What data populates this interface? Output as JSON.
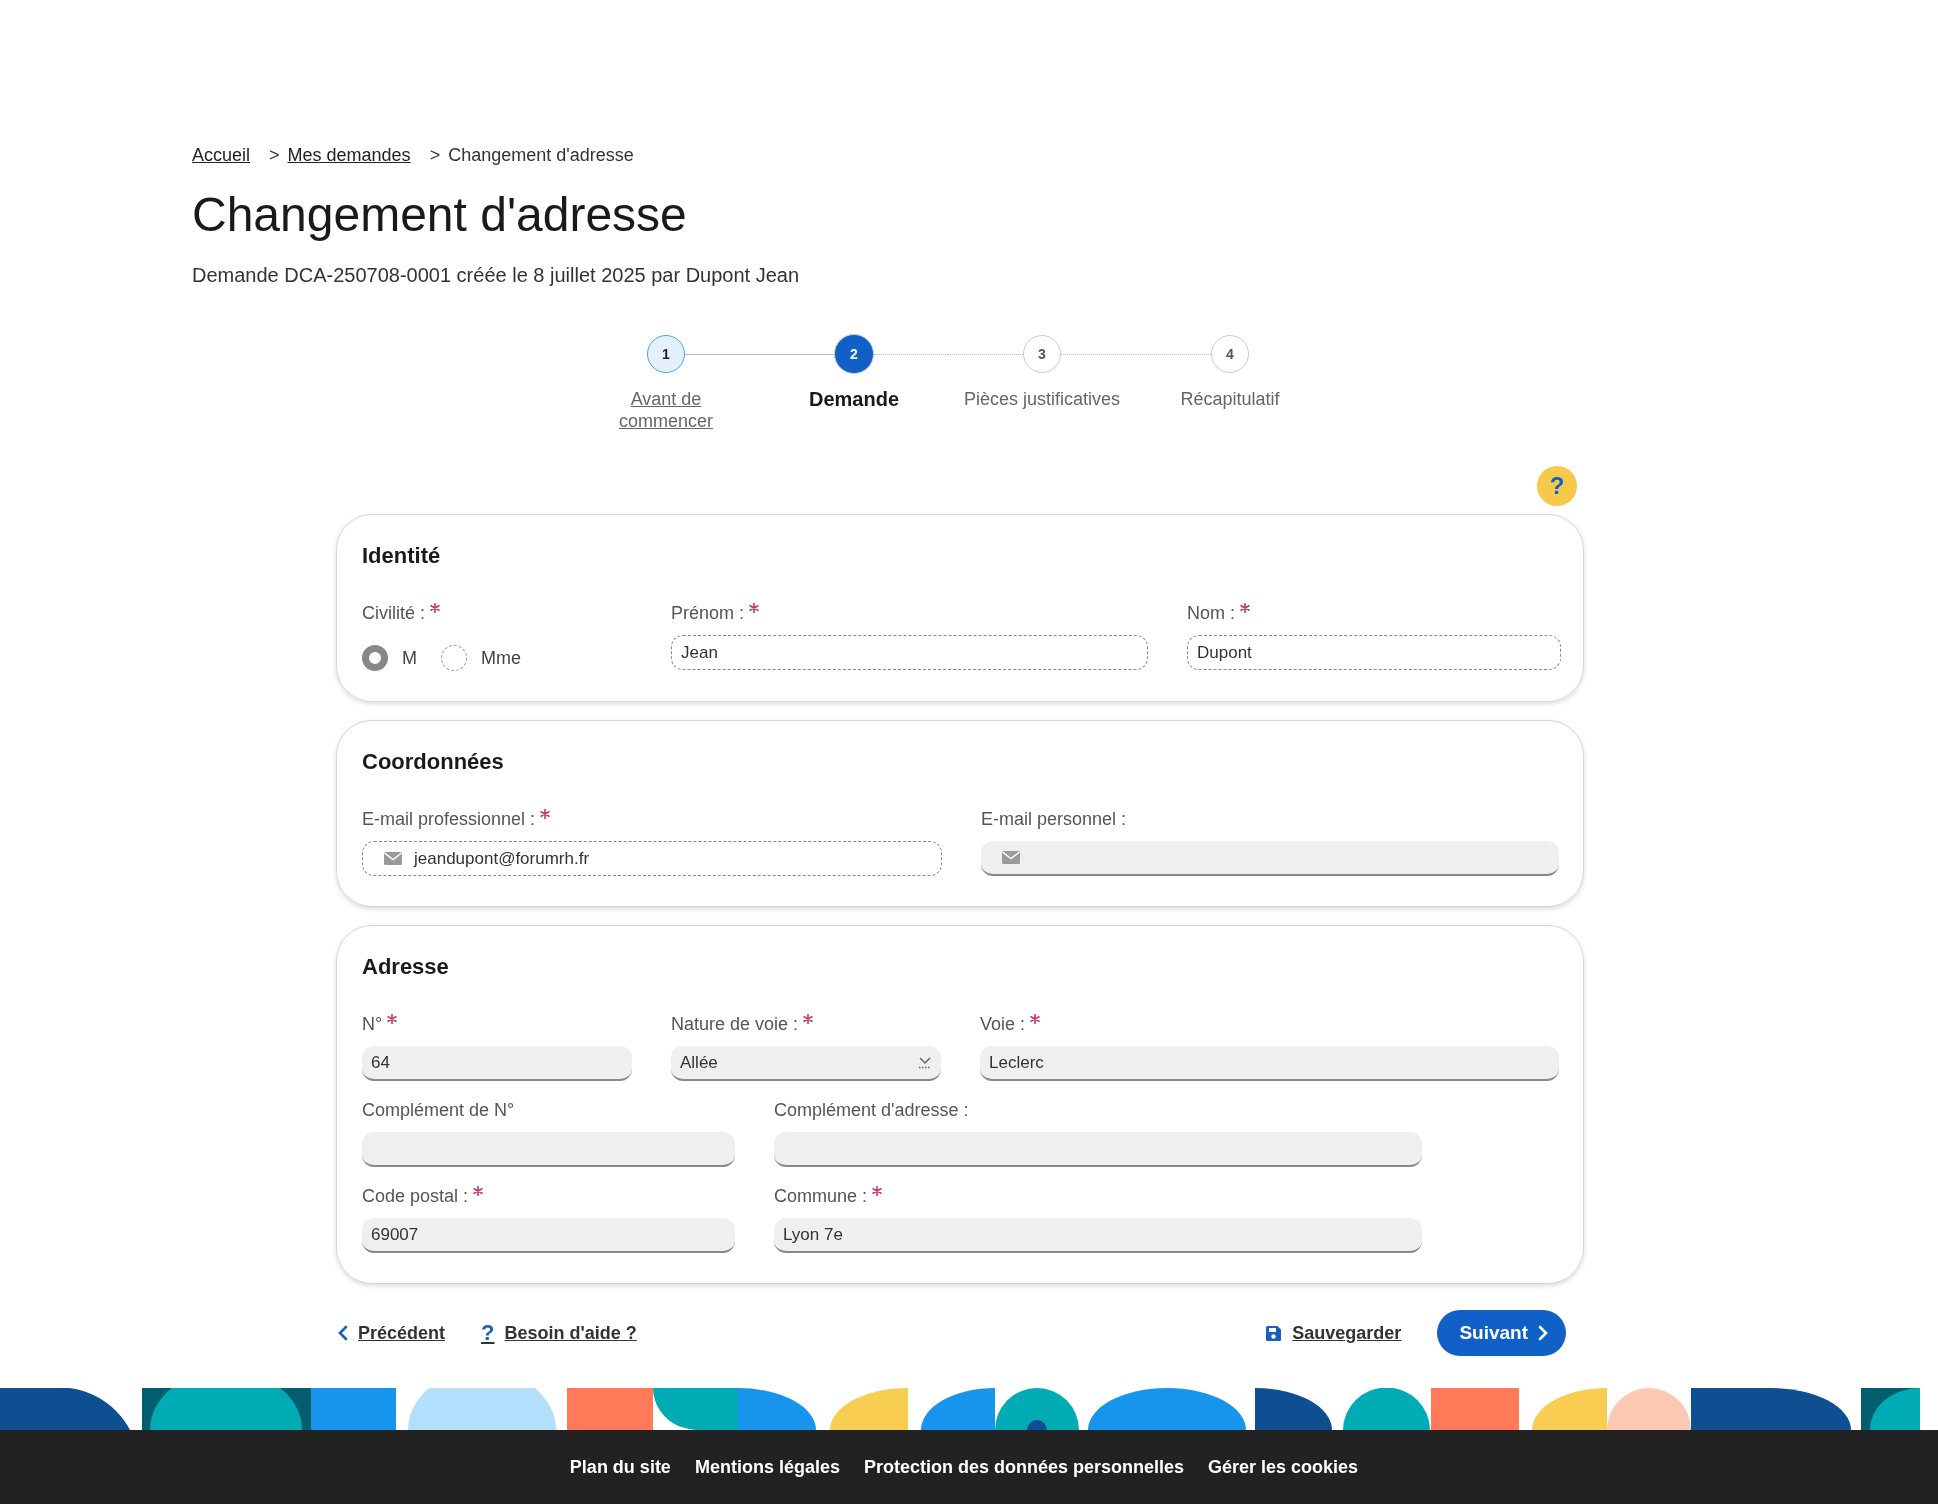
{
  "breadcrumb": [
    {
      "label": "Accueil",
      "link": true
    },
    {
      "label": "Mes demandes",
      "link": true
    },
    {
      "label": "Changement d'adresse",
      "link": false
    }
  ],
  "breadcrumb_separator": ">",
  "title": "Changement d'adresse",
  "subtitle": "Demande DCA-250708-0001 créée le 8 juillet 2025 par Dupont Jean",
  "steps": [
    {
      "number": "1",
      "label": "Avant de commencer",
      "completed": true,
      "selected": false
    },
    {
      "number": "2",
      "label": "Demande",
      "completed": false,
      "selected": true
    },
    {
      "number": "3",
      "label": "Pièces justificatives",
      "completed": false,
      "selected": false
    },
    {
      "number": "4",
      "label": "Récapitulatif",
      "completed": false,
      "selected": false
    }
  ],
  "help_button": {
    "glyph": "?"
  },
  "sections": [
    {
      "title": "Identité",
      "rows": [
        {
          "fields": [
            {
              "kind": "radio",
              "label": "Civilité :",
              "required": true,
              "options": [
                {
                  "label": "M",
                  "selected": true
                },
                {
                  "label": "Mme",
                  "selected": false
                }
              ]
            },
            {
              "kind": "text",
              "label": "Prénom :",
              "required": true,
              "value": "Jean",
              "readonly": true
            },
            {
              "kind": "text",
              "label": "Nom :",
              "required": true,
              "value": "Dupont",
              "readonly": true
            }
          ]
        }
      ]
    },
    {
      "title": "Coordonnées",
      "rows": [
        {
          "fields": [
            {
              "kind": "email",
              "label": "E-mail professionnel :",
              "required": true,
              "value": "jeandupont@forumrh.fr",
              "readonly": true
            },
            {
              "kind": "email",
              "label": "E-mail personnel :",
              "required": false,
              "readonly": false
            }
          ]
        }
      ]
    },
    {
      "title": "Adresse",
      "rows": [
        {
          "fields": [
            {
              "kind": "text",
              "label": "N°",
              "required": true,
              "value": "64",
              "readonly": false
            },
            {
              "kind": "select",
              "label": "Nature de voie :",
              "required": true,
              "value": "Allée",
              "readonly": false
            },
            {
              "kind": "text",
              "label": "Voie :",
              "required": true,
              "value": "Leclerc",
              "readonly": false
            }
          ]
        },
        {
          "fields": [
            {
              "kind": "text",
              "label": "Complément de N°",
              "required": false,
              "readonly": false
            },
            {
              "kind": "text",
              "label": "Complément d'adresse :",
              "required": false,
              "readonly": false
            }
          ]
        },
        {
          "fields": [
            {
              "kind": "text",
              "label": "Code postal :",
              "required": true,
              "value": "69007",
              "readonly": false
            },
            {
              "kind": "text",
              "label": "Commune :",
              "required": true,
              "value": "Lyon 7e",
              "readonly": false
            }
          ]
        }
      ]
    }
  ],
  "actions": {
    "previous": "Précédent",
    "help": {
      "glyph": "?",
      "label": "Besoin d'aide ?"
    },
    "save": "Sauvegarder",
    "next": "Suivant"
  },
  "footer_links": [
    "Plan du site",
    "Mentions légales",
    "Protection des données personnelles",
    "Gérer les cookies"
  ]
}
